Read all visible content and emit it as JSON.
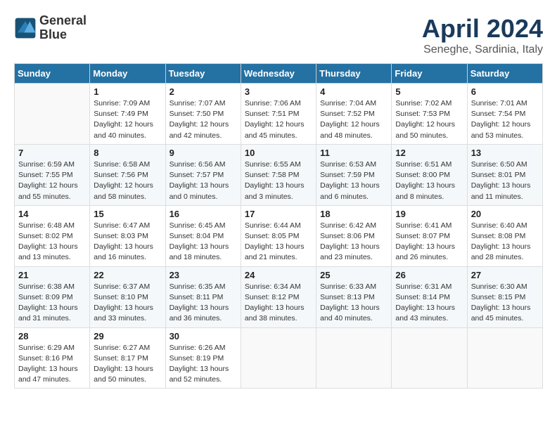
{
  "header": {
    "logo_line1": "General",
    "logo_line2": "Blue",
    "month": "April 2024",
    "location": "Seneghe, Sardinia, Italy"
  },
  "weekdays": [
    "Sunday",
    "Monday",
    "Tuesday",
    "Wednesday",
    "Thursday",
    "Friday",
    "Saturday"
  ],
  "weeks": [
    [
      {
        "day": "",
        "info": ""
      },
      {
        "day": "1",
        "info": "Sunrise: 7:09 AM\nSunset: 7:49 PM\nDaylight: 12 hours\nand 40 minutes."
      },
      {
        "day": "2",
        "info": "Sunrise: 7:07 AM\nSunset: 7:50 PM\nDaylight: 12 hours\nand 42 minutes."
      },
      {
        "day": "3",
        "info": "Sunrise: 7:06 AM\nSunset: 7:51 PM\nDaylight: 12 hours\nand 45 minutes."
      },
      {
        "day": "4",
        "info": "Sunrise: 7:04 AM\nSunset: 7:52 PM\nDaylight: 12 hours\nand 48 minutes."
      },
      {
        "day": "5",
        "info": "Sunrise: 7:02 AM\nSunset: 7:53 PM\nDaylight: 12 hours\nand 50 minutes."
      },
      {
        "day": "6",
        "info": "Sunrise: 7:01 AM\nSunset: 7:54 PM\nDaylight: 12 hours\nand 53 minutes."
      }
    ],
    [
      {
        "day": "7",
        "info": "Sunrise: 6:59 AM\nSunset: 7:55 PM\nDaylight: 12 hours\nand 55 minutes."
      },
      {
        "day": "8",
        "info": "Sunrise: 6:58 AM\nSunset: 7:56 PM\nDaylight: 12 hours\nand 58 minutes."
      },
      {
        "day": "9",
        "info": "Sunrise: 6:56 AM\nSunset: 7:57 PM\nDaylight: 13 hours\nand 0 minutes."
      },
      {
        "day": "10",
        "info": "Sunrise: 6:55 AM\nSunset: 7:58 PM\nDaylight: 13 hours\nand 3 minutes."
      },
      {
        "day": "11",
        "info": "Sunrise: 6:53 AM\nSunset: 7:59 PM\nDaylight: 13 hours\nand 6 minutes."
      },
      {
        "day": "12",
        "info": "Sunrise: 6:51 AM\nSunset: 8:00 PM\nDaylight: 13 hours\nand 8 minutes."
      },
      {
        "day": "13",
        "info": "Sunrise: 6:50 AM\nSunset: 8:01 PM\nDaylight: 13 hours\nand 11 minutes."
      }
    ],
    [
      {
        "day": "14",
        "info": "Sunrise: 6:48 AM\nSunset: 8:02 PM\nDaylight: 13 hours\nand 13 minutes."
      },
      {
        "day": "15",
        "info": "Sunrise: 6:47 AM\nSunset: 8:03 PM\nDaylight: 13 hours\nand 16 minutes."
      },
      {
        "day": "16",
        "info": "Sunrise: 6:45 AM\nSunset: 8:04 PM\nDaylight: 13 hours\nand 18 minutes."
      },
      {
        "day": "17",
        "info": "Sunrise: 6:44 AM\nSunset: 8:05 PM\nDaylight: 13 hours\nand 21 minutes."
      },
      {
        "day": "18",
        "info": "Sunrise: 6:42 AM\nSunset: 8:06 PM\nDaylight: 13 hours\nand 23 minutes."
      },
      {
        "day": "19",
        "info": "Sunrise: 6:41 AM\nSunset: 8:07 PM\nDaylight: 13 hours\nand 26 minutes."
      },
      {
        "day": "20",
        "info": "Sunrise: 6:40 AM\nSunset: 8:08 PM\nDaylight: 13 hours\nand 28 minutes."
      }
    ],
    [
      {
        "day": "21",
        "info": "Sunrise: 6:38 AM\nSunset: 8:09 PM\nDaylight: 13 hours\nand 31 minutes."
      },
      {
        "day": "22",
        "info": "Sunrise: 6:37 AM\nSunset: 8:10 PM\nDaylight: 13 hours\nand 33 minutes."
      },
      {
        "day": "23",
        "info": "Sunrise: 6:35 AM\nSunset: 8:11 PM\nDaylight: 13 hours\nand 36 minutes."
      },
      {
        "day": "24",
        "info": "Sunrise: 6:34 AM\nSunset: 8:12 PM\nDaylight: 13 hours\nand 38 minutes."
      },
      {
        "day": "25",
        "info": "Sunrise: 6:33 AM\nSunset: 8:13 PM\nDaylight: 13 hours\nand 40 minutes."
      },
      {
        "day": "26",
        "info": "Sunrise: 6:31 AM\nSunset: 8:14 PM\nDaylight: 13 hours\nand 43 minutes."
      },
      {
        "day": "27",
        "info": "Sunrise: 6:30 AM\nSunset: 8:15 PM\nDaylight: 13 hours\nand 45 minutes."
      }
    ],
    [
      {
        "day": "28",
        "info": "Sunrise: 6:29 AM\nSunset: 8:16 PM\nDaylight: 13 hours\nand 47 minutes."
      },
      {
        "day": "29",
        "info": "Sunrise: 6:27 AM\nSunset: 8:17 PM\nDaylight: 13 hours\nand 50 minutes."
      },
      {
        "day": "30",
        "info": "Sunrise: 6:26 AM\nSunset: 8:19 PM\nDaylight: 13 hours\nand 52 minutes."
      },
      {
        "day": "",
        "info": ""
      },
      {
        "day": "",
        "info": ""
      },
      {
        "day": "",
        "info": ""
      },
      {
        "day": "",
        "info": ""
      }
    ]
  ]
}
